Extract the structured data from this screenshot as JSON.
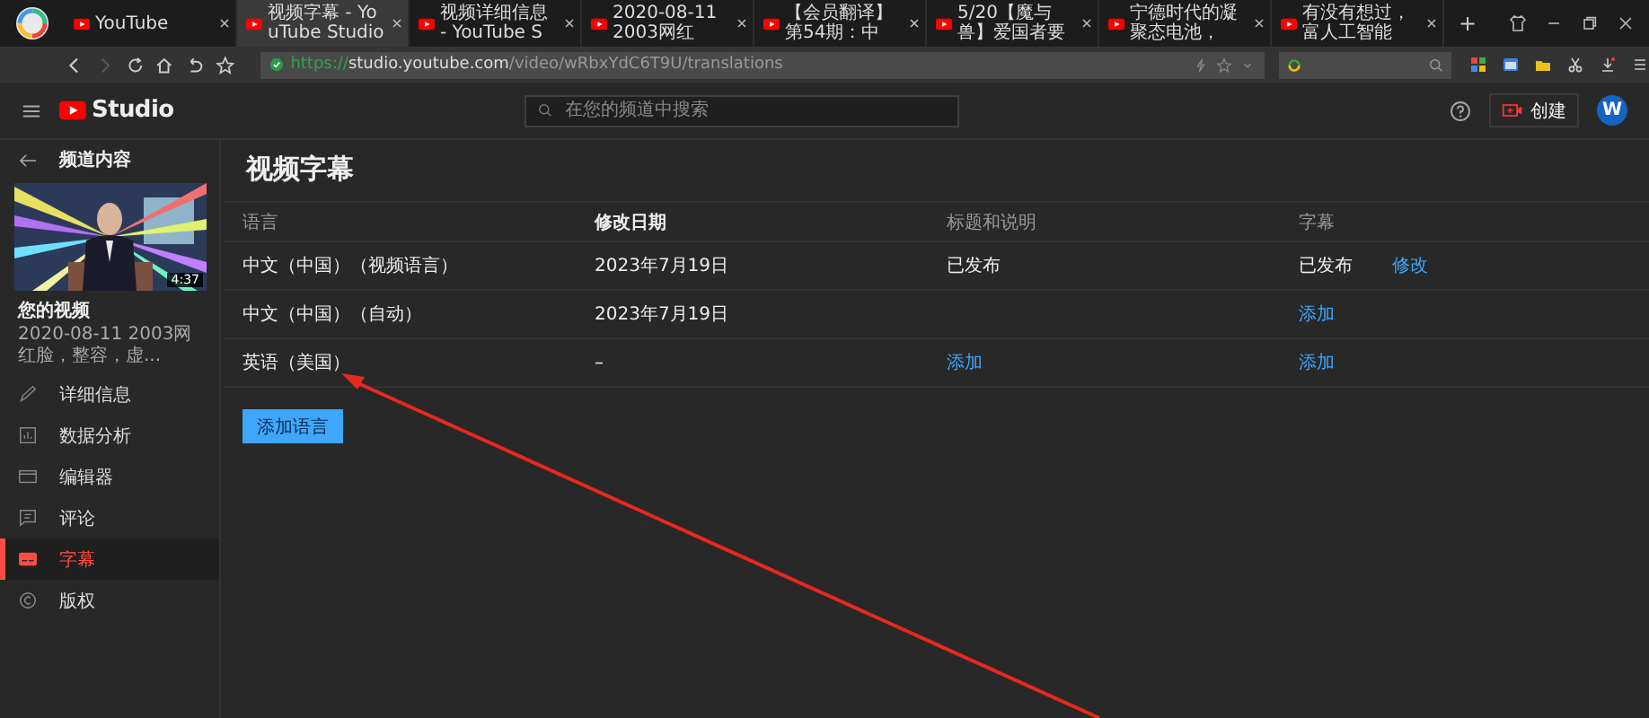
{
  "browser": {
    "tabs": [
      {
        "title": "YouTube",
        "selected": false
      },
      {
        "title": "视频字幕 - YouTube Studio",
        "selected": true
      },
      {
        "title": "视频详细信息 - YouTube S",
        "selected": false
      },
      {
        "title": "2020-08-11 2003网红",
        "selected": false
      },
      {
        "title": "【会员翻译】第54期：中",
        "selected": false
      },
      {
        "title": "5/20【魔与兽】爱国者要",
        "selected": false
      },
      {
        "title": "宁德时代的凝聚态电池，",
        "selected": false
      },
      {
        "title": "有没有想过，富人工智能",
        "selected": false
      }
    ],
    "new_tab": "+",
    "forward_disabled": true,
    "url_scheme": "https://",
    "url_host": "studio.youtube.com",
    "url_path": "/video/wRbxYdC6T9U/translations"
  },
  "header": {
    "logo_text": "Studio",
    "search": {
      "placeholder": "在您的频道中搜索"
    },
    "create_button": "创建",
    "avatar": "W"
  },
  "sidebar": {
    "back_label": "频道内容",
    "video": {
      "duration": "4:37",
      "title": "您的视频",
      "subtitle": "2020-08-11 2003网红脸，整容，虚..."
    },
    "items": [
      {
        "kind": "details",
        "label": "详细信息",
        "selected": false
      },
      {
        "kind": "analytics",
        "label": "数据分析",
        "selected": false
      },
      {
        "kind": "editor",
        "label": "编辑器",
        "selected": false
      },
      {
        "kind": "comments",
        "label": "评论",
        "selected": false
      },
      {
        "kind": "subtitles",
        "label": "字幕",
        "selected": true
      },
      {
        "kind": "copyright",
        "label": "版权",
        "selected": false
      }
    ]
  },
  "page": {
    "title": "视频字幕",
    "columns": [
      {
        "label": "语言",
        "bold": false
      },
      {
        "label": "修改日期",
        "bold": true
      },
      {
        "label": "标题和说明",
        "bold": false
      },
      {
        "label": "字幕",
        "bold": false
      }
    ],
    "rows": [
      {
        "cells": [
          [
            {
              "kind": "text",
              "text": "中文（中国）（视频语言）"
            }
          ],
          [
            {
              "kind": "text",
              "text": "2023年7月19日"
            }
          ],
          [
            {
              "kind": "text",
              "text": "已发布"
            }
          ],
          [
            {
              "kind": "text",
              "text": "已发布"
            },
            {
              "kind": "link",
              "text": "修改"
            }
          ]
        ]
      },
      {
        "cells": [
          [
            {
              "kind": "text",
              "text": "中文（中国）（自动）"
            }
          ],
          [
            {
              "kind": "text",
              "text": "2023年7月19日"
            }
          ],
          [],
          [
            {
              "kind": "link",
              "text": "添加"
            }
          ]
        ]
      },
      {
        "cells": [
          [
            {
              "kind": "text",
              "text": "英语（美国）"
            }
          ],
          [
            {
              "kind": "text",
              "text": "–"
            }
          ],
          [
            {
              "kind": "link",
              "text": "添加"
            }
          ],
          [
            {
              "kind": "link",
              "text": "添加"
            }
          ]
        ]
      }
    ],
    "add_language_button": "添加语言"
  }
}
